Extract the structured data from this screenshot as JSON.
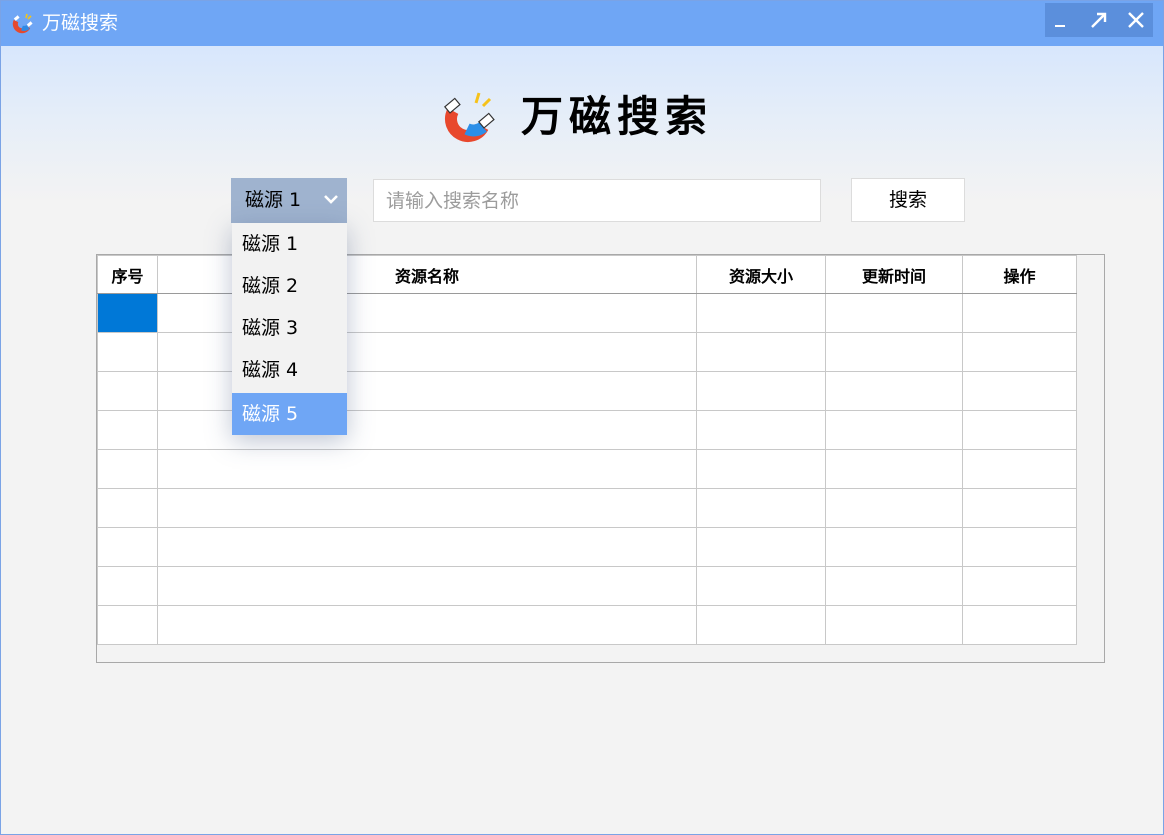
{
  "window": {
    "title": "万磁搜索",
    "controls": [
      "minimize",
      "maximize",
      "close"
    ]
  },
  "brand": {
    "text": "万磁搜索",
    "icon": "magnet-icon"
  },
  "source_select": {
    "value": "磁源 1",
    "options": [
      "磁源 1",
      "磁源 2",
      "磁源 3",
      "磁源 4",
      "磁源 5"
    ],
    "highlighted_option": "磁源 5"
  },
  "search": {
    "placeholder": "请输入搜索名称",
    "value": "",
    "button_label": "搜索"
  },
  "table": {
    "columns": [
      "序号",
      "资源名称",
      "资源大小",
      "更新时间",
      "操作"
    ],
    "row_count": 9,
    "selected_row": 1,
    "rows": []
  },
  "colors": {
    "titlebar": "#6fa6f5",
    "select_bg": "#9fb3cf",
    "selection": "#0078d7",
    "dropdown_highlight": "#6fa6f5"
  }
}
